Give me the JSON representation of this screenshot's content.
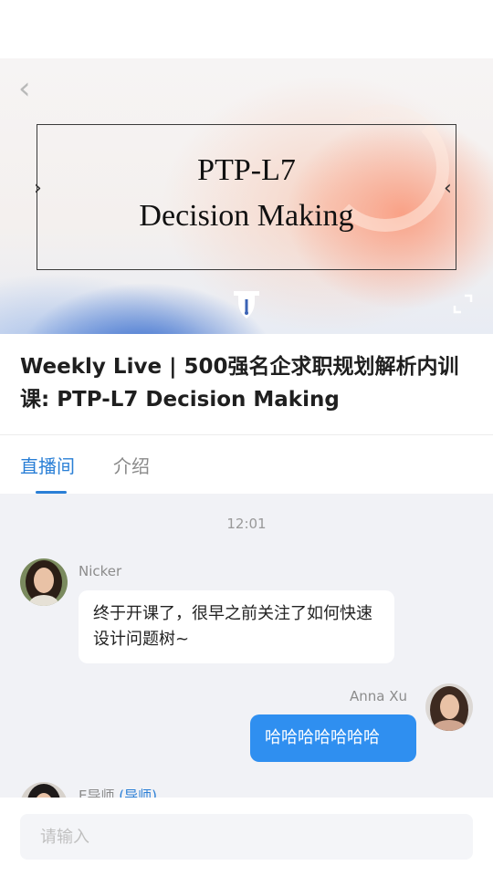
{
  "hero": {
    "line1": "PTP-L7",
    "line2": "Decision Making"
  },
  "course": {
    "title": "Weekly Live | 500强名企求职规划解析内训课: PTP-L7 Decision Making"
  },
  "tabs": [
    {
      "label": "直播间",
      "active": true
    },
    {
      "label": "介绍",
      "active": false
    }
  ],
  "chat": {
    "time": "12:01",
    "messages": [
      {
        "sender": "Nicker",
        "text": "终于开课了，很早之前关注了如何快速设计问题树~",
        "side": "left"
      },
      {
        "sender": "Anna Xu",
        "text": "哈哈哈哈哈哈哈",
        "side": "right"
      },
      {
        "sender": "E导师",
        "role": "(导师)",
        "side": "left"
      }
    ]
  },
  "input": {
    "placeholder": "请输入"
  },
  "colors": {
    "accent": "#2a7fd6",
    "bubble_self": "#2f8ff0",
    "chat_bg": "#f1f2f6"
  },
  "icons": {
    "back": "chevron-left-icon",
    "fullscreen": "expand-icon",
    "logo": "pen-nib-logo-icon"
  }
}
